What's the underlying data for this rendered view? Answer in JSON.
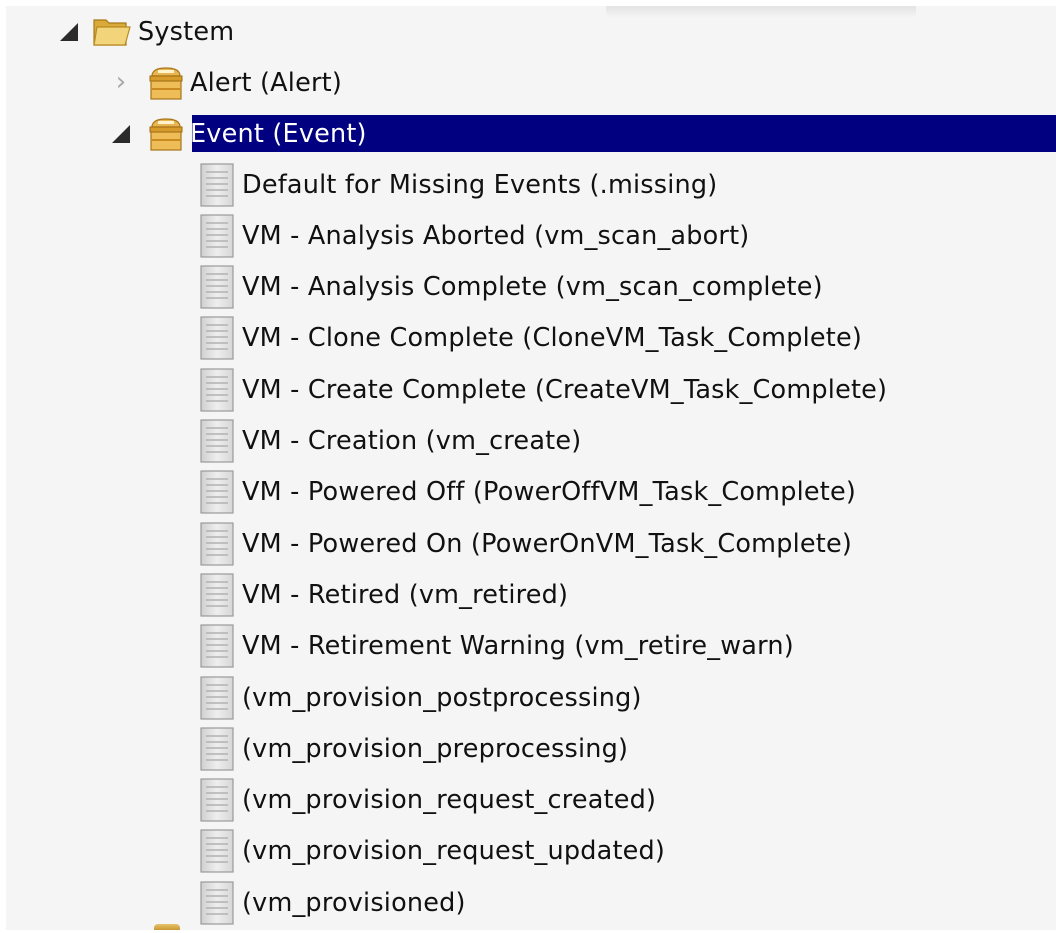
{
  "tree": {
    "root": {
      "label": "System",
      "icon": "folder-icon",
      "expanded": true
    },
    "alert": {
      "label": "Alert (Alert)",
      "icon": "class-icon",
      "expanded": false
    },
    "event": {
      "label": "Event (Event)",
      "icon": "class-icon",
      "expanded": true,
      "selected": true
    },
    "instances": [
      {
        "label": "Default for Missing Events (.missing)"
      },
      {
        "label": "VM - Analysis Aborted (vm_scan_abort)"
      },
      {
        "label": "VM - Analysis Complete (vm_scan_complete)"
      },
      {
        "label": "VM - Clone Complete (CloneVM_Task_Complete)"
      },
      {
        "label": "VM - Create Complete (CreateVM_Task_Complete)"
      },
      {
        "label": "VM - Creation (vm_create)"
      },
      {
        "label": "VM - Powered Off (PowerOffVM_Task_Complete)"
      },
      {
        "label": "VM - Powered On (PowerOnVM_Task_Complete)"
      },
      {
        "label": "VM - Retired (vm_retired)"
      },
      {
        "label": "VM - Retirement Warning (vm_retire_warn)"
      },
      {
        "label": "(vm_provision_postprocessing)"
      },
      {
        "label": "(vm_provision_preprocessing)"
      },
      {
        "label": "(vm_provision_request_created)"
      },
      {
        "label": "(vm_provision_request_updated)"
      },
      {
        "label": "(vm_provisioned)"
      }
    ]
  },
  "colors": {
    "selection": "#000080",
    "selection_text": "#ffffff",
    "background": "#f5f5f5",
    "text": "#111111",
    "folder": "#e8c25a",
    "class_icon": "#d99a2b"
  }
}
